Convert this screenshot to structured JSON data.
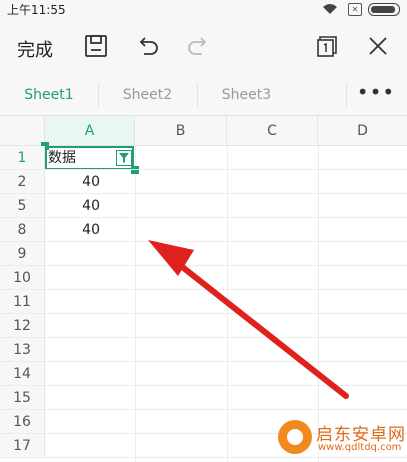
{
  "status_bar": {
    "time": "上午11:55"
  },
  "toolbar": {
    "done_label": "完成"
  },
  "tabs": [
    {
      "label": "Sheet1",
      "active": true
    },
    {
      "label": "Sheet2",
      "active": false
    },
    {
      "label": "Sheet3",
      "active": false
    }
  ],
  "more_label": "•••",
  "columns": [
    "A",
    "B",
    "C",
    "D"
  ],
  "rows": [
    {
      "label": "1",
      "active": true
    },
    {
      "label": "2"
    },
    {
      "label": "5"
    },
    {
      "label": "8"
    },
    {
      "label": "9"
    },
    {
      "label": "10"
    },
    {
      "label": "11"
    },
    {
      "label": "12"
    },
    {
      "label": "13"
    },
    {
      "label": "14"
    },
    {
      "label": "15"
    },
    {
      "label": "16"
    },
    {
      "label": "17"
    }
  ],
  "cells": {
    "A1": "数据",
    "A2": "40",
    "A5": "40",
    "A8": "40"
  },
  "colors": {
    "accent": "#1e9e76",
    "arrow": "#e0201c"
  },
  "watermark": {
    "title": "启东安卓网",
    "url": "www.qdltdq.com"
  }
}
